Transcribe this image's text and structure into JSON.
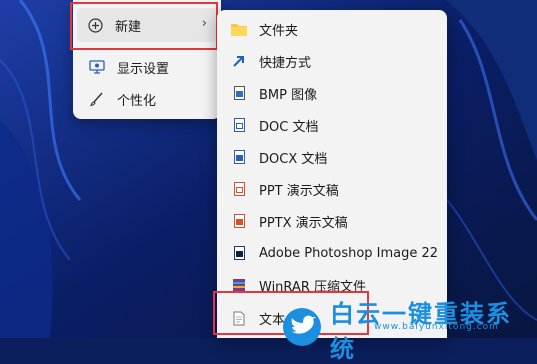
{
  "context_menu": {
    "new_label": "新建",
    "display_label": "显示设置",
    "personalize_label": "个性化"
  },
  "new_submenu": {
    "items": [
      {
        "label": "文件夹",
        "icon": "folder-icon"
      },
      {
        "label": "快捷方式",
        "icon": "shortcut-icon"
      },
      {
        "label": "BMP 图像",
        "icon": "bmp-file-icon"
      },
      {
        "label": "DOC 文档",
        "icon": "doc-file-icon"
      },
      {
        "label": "DOCX 文档",
        "icon": "docx-file-icon"
      },
      {
        "label": "PPT 演示文稿",
        "icon": "ppt-file-icon"
      },
      {
        "label": "PPTX 演示文稿",
        "icon": "pptx-file-icon"
      },
      {
        "label": "Adobe Photoshop Image 22",
        "icon": "psd-file-icon"
      },
      {
        "label": "WinRAR 压缩文件",
        "icon": "rar-file-icon"
      },
      {
        "label": "文本",
        "icon": "txt-file-icon"
      }
    ]
  },
  "watermark": {
    "text": "白云一键重装系统",
    "url": "www.baiyunxitong.com"
  },
  "colors": {
    "highlight_box": "#e0383e",
    "watermark": "#1d8fe0"
  }
}
